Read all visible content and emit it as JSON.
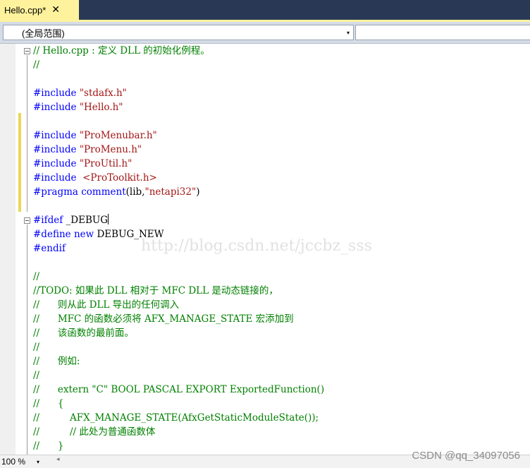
{
  "tab": {
    "title": "Hello.cpp*",
    "close_glyph": "✕"
  },
  "navigation": {
    "scope": "(全局范围)",
    "dropdown_arrow": "▾",
    "member": ""
  },
  "code_lines": [
    [
      {
        "t": "// Hello.cpp : 定义 DLL 的初始化例程。",
        "c": "comment"
      }
    ],
    [
      {
        "t": "//",
        "c": "comment"
      }
    ],
    [],
    [
      {
        "t": "#include ",
        "c": "prep"
      },
      {
        "t": "\"stdafx.h\"",
        "c": "str"
      }
    ],
    [
      {
        "t": "#include ",
        "c": "prep"
      },
      {
        "t": "\"Hello.h\"",
        "c": "str"
      }
    ],
    [],
    [
      {
        "t": "#include ",
        "c": "prep"
      },
      {
        "t": "\"ProMenubar.h\"",
        "c": "str"
      }
    ],
    [
      {
        "t": "#include ",
        "c": "prep"
      },
      {
        "t": "\"ProMenu.h\"",
        "c": "str"
      }
    ],
    [
      {
        "t": "#include ",
        "c": "prep"
      },
      {
        "t": "\"ProUtil.h\"",
        "c": "str"
      }
    ],
    [
      {
        "t": "#include  ",
        "c": "prep"
      },
      {
        "t": "<ProToolkit.h>",
        "c": "str"
      }
    ],
    [
      {
        "t": "#pragma comment",
        "c": "prep"
      },
      {
        "t": "(lib,",
        "c": "norm"
      },
      {
        "t": "\"netapi32\"",
        "c": "str"
      },
      {
        "t": ")",
        "c": "norm"
      }
    ],
    [],
    [
      {
        "t": "#ifdef ",
        "c": "prep"
      },
      {
        "t": "_DEBUG",
        "c": "norm"
      }
    ],
    [
      {
        "t": "#define ",
        "c": "prep"
      },
      {
        "t": "new ",
        "c": "prep"
      },
      {
        "t": "DEBUG_NEW",
        "c": "norm"
      }
    ],
    [
      {
        "t": "#endif",
        "c": "prep"
      }
    ],
    [],
    [
      {
        "t": "//",
        "c": "comment"
      }
    ],
    [
      {
        "t": "//TODO: 如果此 DLL 相对于 MFC DLL 是动态链接的，",
        "c": "comment"
      }
    ],
    [
      {
        "t": "//      则从此 DLL 导出的任何调入",
        "c": "comment"
      }
    ],
    [
      {
        "t": "//      MFC 的函数必须将 AFX_MANAGE_STATE 宏添加到",
        "c": "comment"
      }
    ],
    [
      {
        "t": "//      该函数的最前面。",
        "c": "comment"
      }
    ],
    [
      {
        "t": "//",
        "c": "comment"
      }
    ],
    [
      {
        "t": "//      例如:",
        "c": "comment"
      }
    ],
    [
      {
        "t": "//",
        "c": "comment"
      }
    ],
    [
      {
        "t": "//      extern \"C\" BOOL PASCAL EXPORT ExportedFunction()",
        "c": "comment"
      }
    ],
    [
      {
        "t": "//      {",
        "c": "comment"
      }
    ],
    [
      {
        "t": "//          AFX_MANAGE_STATE(AfxGetStaticModuleState());",
        "c": "comment"
      }
    ],
    [
      {
        "t": "//          // 此处为普通函数体",
        "c": "comment"
      }
    ],
    [
      {
        "t": "//      }",
        "c": "comment"
      }
    ]
  ],
  "colors": {
    "comment": "#008000",
    "prep": "#0000ff",
    "str": "#a31515",
    "norm": "#000000"
  },
  "watermark": "http://blog.csdn.net/jccbz_sss",
  "statusbar": {
    "zoom": "100 %",
    "zoom_arrow": "▾",
    "scroll_left": "◂"
  },
  "credit": "CSDN @qq_34097056"
}
